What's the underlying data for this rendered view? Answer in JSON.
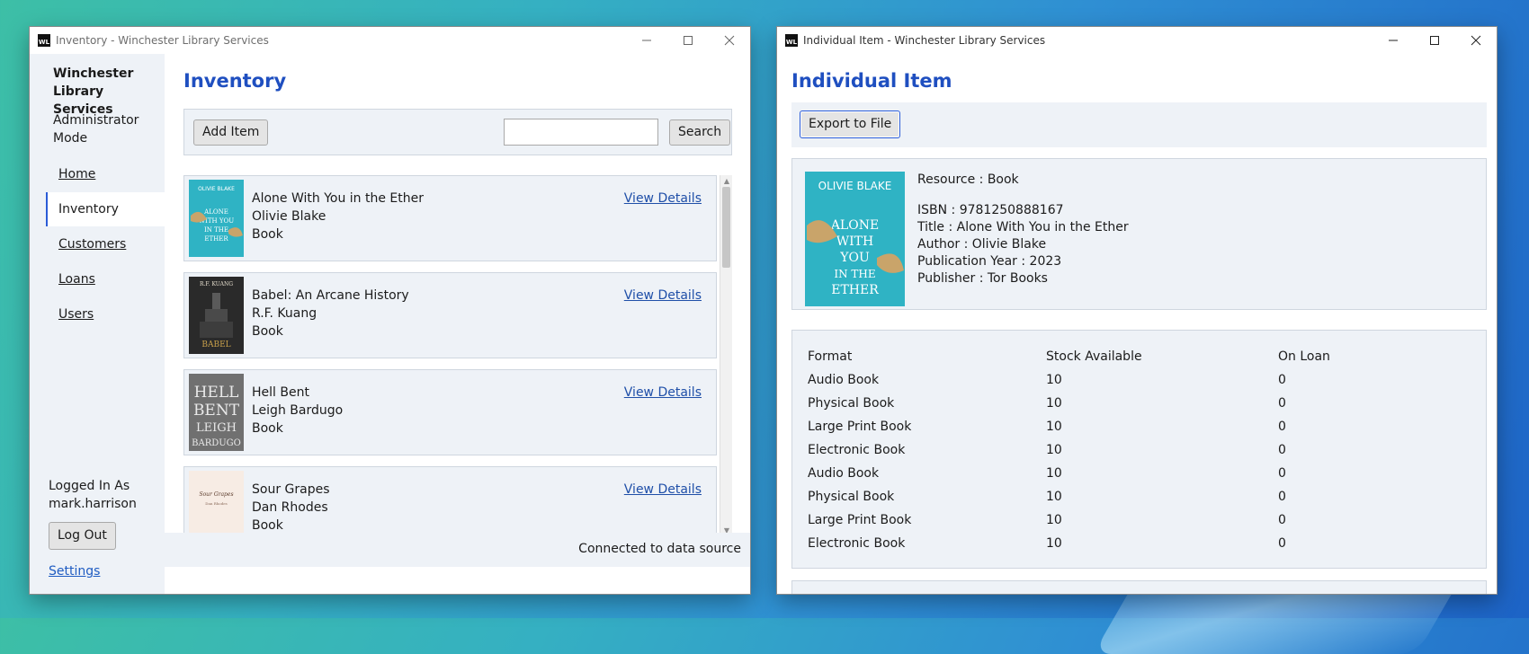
{
  "colors": {
    "accent": "#1f4fc0",
    "link": "#1f4fa8",
    "panel": "#eef2f7"
  },
  "inventory_window": {
    "title": "Inventory - Winchester Library Services",
    "sidebar": {
      "brand": "Winchester Library Services",
      "mode": "Administrator Mode",
      "nav": [
        {
          "label": "Home"
        },
        {
          "label": "Inventory",
          "active": true
        },
        {
          "label": "Customers"
        },
        {
          "label": "Loans"
        },
        {
          "label": "Users"
        }
      ],
      "logged_in_label": "Logged In As",
      "username": "mark.harrison",
      "logout_label": "Log Out",
      "settings_label": "Settings"
    },
    "page_title": "Inventory",
    "toolbar": {
      "add_label": "Add Item",
      "search_value": "",
      "search_label": "Search"
    },
    "items": [
      {
        "title": "Alone With You in the Ether",
        "author": "Olivie Blake",
        "type": "Book",
        "link": "View Details",
        "cover_icon": "book-cover-teal",
        "cover_color": "#2fb3c4",
        "cover_text": "OLIVIE BLAKE · ALONE WITH YOU IN THE ETHER"
      },
      {
        "title": "Babel: An Arcane History",
        "author": "R.F. Kuang",
        "type": "Book",
        "link": "View Details",
        "cover_icon": "book-cover-dark",
        "cover_color": "#2a2a2a",
        "cover_text": "R.F. KUANG · BABEL"
      },
      {
        "title": "Hell Bent",
        "author": "Leigh Bardugo",
        "type": "Book",
        "link": "View Details",
        "cover_icon": "book-cover-grey",
        "cover_color": "#6f6f6f",
        "cover_text": "HELL BENT · LEIGH BARDUGO"
      },
      {
        "title": "Sour Grapes",
        "author": "Dan Rhodes",
        "type": "Book",
        "link": "View Details",
        "cover_icon": "book-cover-cream",
        "cover_color": "#f7ece4",
        "cover_text": "Sour Grapes"
      }
    ],
    "status": "Connected to data source"
  },
  "detail_window": {
    "title": "Individual Item - Winchester Library Services",
    "page_title": "Individual Item",
    "export_label": "Export to File",
    "cover_icon": "book-cover-teal",
    "resource": "Resource : Book",
    "isbn": "ISBN : 9781250888167",
    "title_line": "Title : Alone With You in the Ether",
    "author_line": "Author : Olivie Blake",
    "year_line": "Publication Year : 2023",
    "publisher_line": "Publisher : Tor Books",
    "stock_headers": [
      "Format",
      "Stock Available",
      "On Loan"
    ],
    "stock_rows": [
      [
        "Audio Book",
        "10",
        "0"
      ],
      [
        "Physical Book",
        "10",
        "0"
      ],
      [
        "Large Print Book",
        "10",
        "0"
      ],
      [
        "Electronic Book",
        "10",
        "0"
      ],
      [
        "Audio Book",
        "10",
        "0"
      ],
      [
        "Physical Book",
        "10",
        "0"
      ],
      [
        "Large Print Book",
        "10",
        "0"
      ],
      [
        "Electronic Book",
        "10",
        "0"
      ]
    ]
  }
}
